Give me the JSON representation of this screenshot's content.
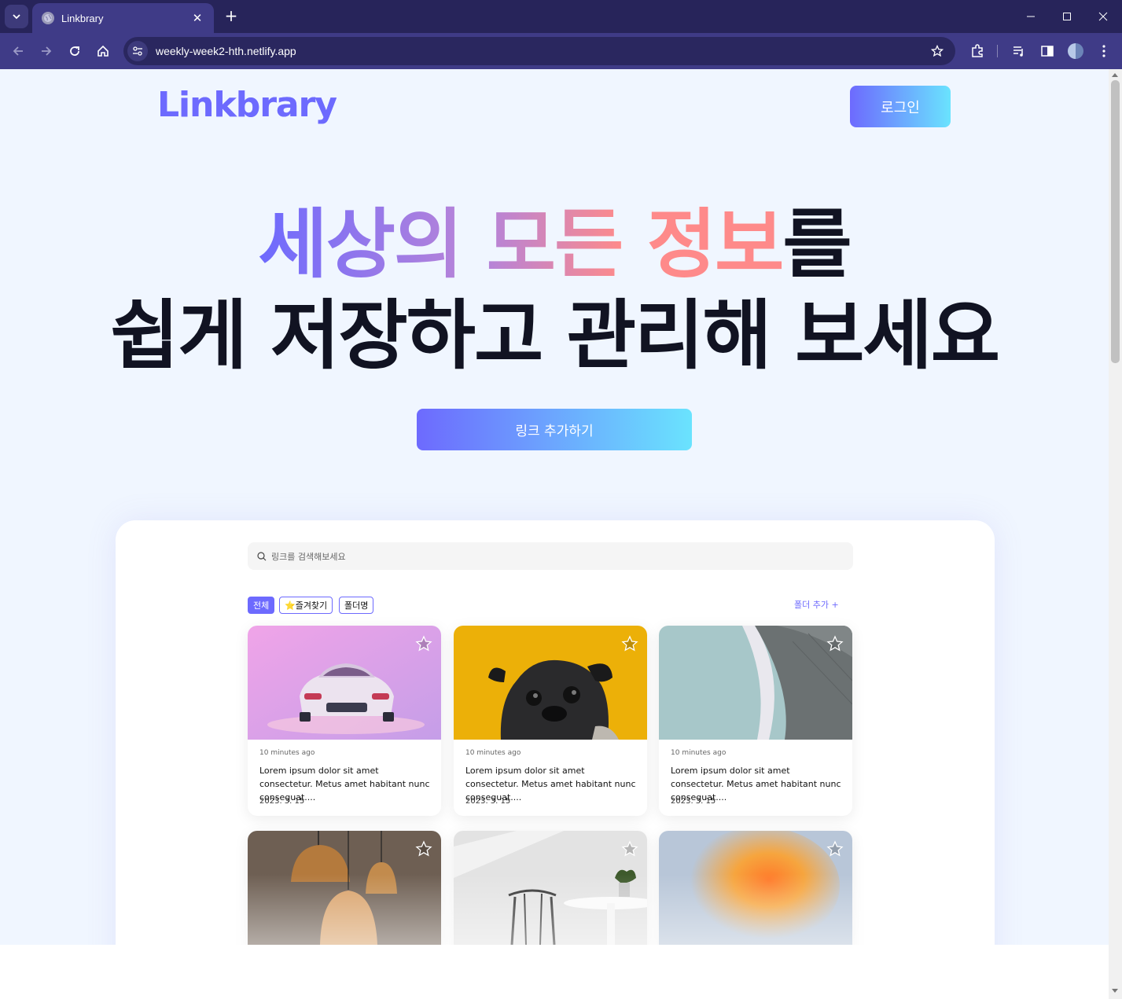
{
  "browser": {
    "tab_title": "Linkbrary",
    "url": "weekly-week2-hth.netlify.app"
  },
  "header": {
    "logo": "Linkbrary",
    "login_label": "로그인"
  },
  "hero": {
    "line1_part1": "세상의",
    "line1_part2": "모든",
    "line1_part3": "정보",
    "line1_part4": "를",
    "line2": "쉽게 저장하고 관리해 보세요",
    "cta_label": "링크 추가하기"
  },
  "preview": {
    "search_placeholder": "링크를 검색해보세요",
    "chips": [
      "전체",
      "⭐즐겨찾기",
      "폴더명"
    ],
    "add_folder": "폴더 추가 +",
    "cards": [
      {
        "time": "10 minutes ago",
        "desc": "Lorem ipsum dolor sit amet consectetur. Metus amet habitant nunc consequat....",
        "date": "2023. 3. 15"
      },
      {
        "time": "10 minutes ago",
        "desc": "Lorem ipsum dolor sit amet consectetur. Metus amet habitant nunc consequat....",
        "date": "2023. 3. 15"
      },
      {
        "time": "10 minutes ago",
        "desc": "Lorem ipsum dolor sit amet consectetur. Metus amet habitant nunc consequat....",
        "date": "2023. 3. 15"
      }
    ]
  },
  "colors": {
    "primary": "#6d6afe",
    "cyan": "#6ae3fe",
    "pink": "#fe8a8a",
    "text_dark": "#111322",
    "page_bg": "#f0f6ff"
  }
}
